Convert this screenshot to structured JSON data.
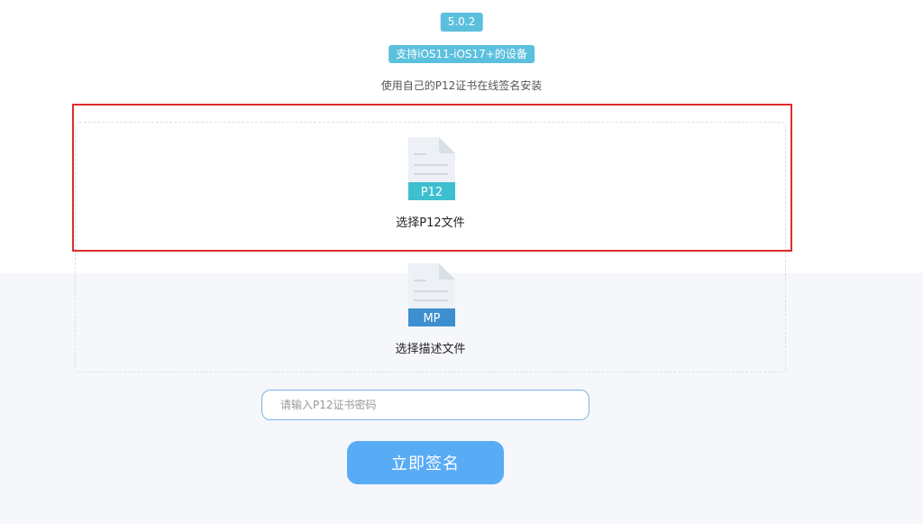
{
  "header": {
    "version": "5.0.2",
    "support": "支持iOS11-iOS17+的设备",
    "subtitle": "使用自己的P12证书在线签名安装"
  },
  "upload": {
    "p12": {
      "tag": "P12",
      "label": "选择P12文件",
      "tag_color": "#3ebfd0"
    },
    "mp": {
      "tag": "MP",
      "label": "选择描述文件",
      "tag_color": "#3d8fd0"
    }
  },
  "password": {
    "placeholder": "请输入P12证书密码",
    "value": ""
  },
  "submit": {
    "label": "立即签名"
  },
  "colors": {
    "badge": "#5bc0de",
    "button": "#58abf5",
    "highlight": "#e02b2b"
  }
}
